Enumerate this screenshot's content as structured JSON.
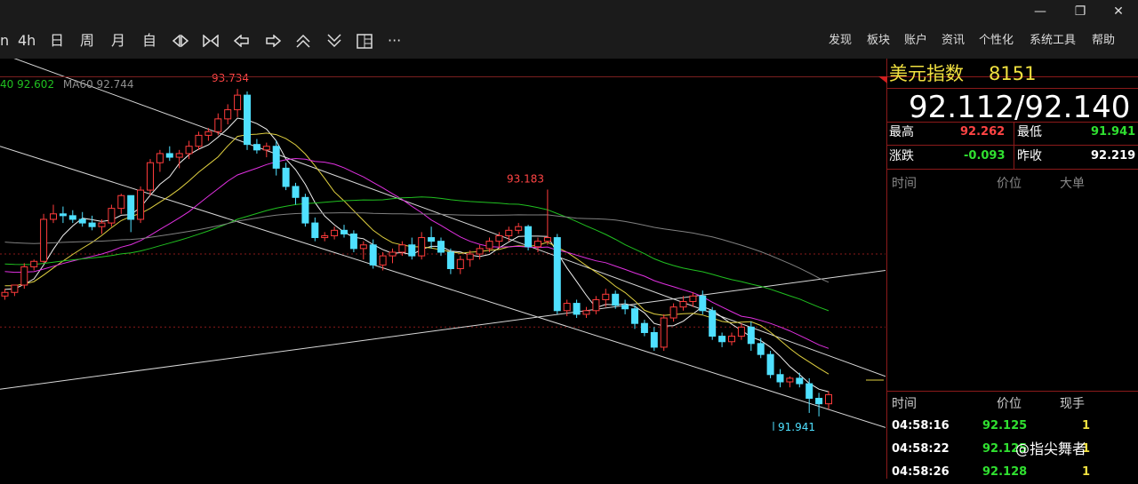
{
  "window": {
    "restore_glyph": "❐",
    "minimize_glyph": "—",
    "close_glyph": "✕"
  },
  "toolbar": {
    "periods": [
      "n",
      "4h",
      "日",
      "周",
      "月",
      "自"
    ],
    "tools": [
      "zoom-in-icon",
      "zoom-out-icon",
      "move-left-icon",
      "move-right-icon",
      "scroll-up-icon",
      "scroll-down-icon",
      "layout-icon",
      "more-icon"
    ],
    "more_label": "···",
    "menu": [
      "发现",
      "板块",
      "账户",
      "资讯",
      "个性化",
      "系统工具",
      "帮助"
    ]
  },
  "legend": {
    "ma40": "40 92.602",
    "ma60": "MA60 92.744"
  },
  "chart_data": {
    "type": "candlestick",
    "ylim": [
      91.6,
      93.9
    ],
    "annotations": [
      {
        "text": "93.734",
        "value": 93.734,
        "color": "#ff4444"
      },
      {
        "text": "93.183",
        "value": 93.183,
        "color": "#ff4444"
      },
      {
        "text": "91.941",
        "value": 91.941,
        "color": "#4fe0ff"
      }
    ],
    "candles": [
      [
        92.6,
        92.64,
        92.58,
        92.62
      ],
      [
        92.62,
        92.66,
        92.6,
        92.66
      ],
      [
        92.66,
        92.78,
        92.64,
        92.76
      ],
      [
        92.76,
        92.8,
        92.74,
        92.79
      ],
      [
        92.79,
        93.05,
        92.78,
        93.02
      ],
      [
        93.02,
        93.1,
        93.0,
        93.05
      ],
      [
        93.05,
        93.09,
        93.0,
        93.04
      ],
      [
        93.04,
        93.07,
        93.0,
        93.02
      ],
      [
        93.02,
        93.06,
        92.98,
        93.0
      ],
      [
        93.0,
        93.04,
        92.96,
        92.98
      ],
      [
        92.98,
        93.02,
        92.94,
        93.0
      ],
      [
        93.0,
        93.1,
        92.98,
        93.08
      ],
      [
        93.08,
        93.16,
        93.05,
        93.15
      ],
      [
        93.15,
        93.13,
        92.95,
        93.02
      ],
      [
        93.02,
        93.2,
        93.0,
        93.18
      ],
      [
        93.18,
        93.35,
        93.15,
        93.33
      ],
      [
        93.33,
        93.4,
        93.28,
        93.38
      ],
      [
        93.38,
        93.42,
        93.34,
        93.36
      ],
      [
        93.36,
        93.4,
        93.3,
        93.38
      ],
      [
        93.38,
        93.45,
        93.35,
        93.42
      ],
      [
        93.42,
        93.5,
        93.4,
        93.48
      ],
      [
        93.48,
        93.52,
        93.45,
        93.5
      ],
      [
        93.5,
        93.6,
        93.48,
        93.57
      ],
      [
        93.57,
        93.65,
        93.54,
        93.62
      ],
      [
        93.62,
        93.734,
        93.58,
        93.7
      ],
      [
        93.7,
        93.72,
        93.4,
        93.43
      ],
      [
        93.43,
        93.46,
        93.38,
        93.4
      ],
      [
        93.4,
        93.44,
        93.36,
        93.42
      ],
      [
        93.42,
        93.45,
        93.26,
        93.3
      ],
      [
        93.3,
        93.33,
        93.18,
        93.2
      ],
      [
        93.2,
        93.22,
        93.1,
        93.14
      ],
      [
        93.14,
        93.16,
        92.98,
        93.0
      ],
      [
        93.0,
        93.03,
        92.9,
        92.92
      ],
      [
        92.92,
        92.95,
        92.9,
        92.93
      ],
      [
        92.93,
        92.98,
        92.91,
        92.96
      ],
      [
        92.96,
        92.99,
        92.92,
        92.94
      ],
      [
        92.94,
        92.96,
        92.84,
        92.86
      ],
      [
        92.86,
        92.9,
        92.8,
        92.88
      ],
      [
        92.88,
        92.91,
        92.75,
        92.77
      ],
      [
        92.77,
        92.84,
        92.74,
        92.82
      ],
      [
        92.82,
        92.86,
        92.78,
        92.84
      ],
      [
        92.84,
        92.9,
        92.82,
        92.88
      ],
      [
        92.88,
        92.92,
        92.8,
        92.82
      ],
      [
        92.82,
        92.95,
        92.8,
        92.92
      ],
      [
        92.92,
        92.98,
        92.86,
        92.9
      ],
      [
        92.9,
        92.92,
        92.82,
        92.84
      ],
      [
        92.84,
        92.86,
        92.72,
        92.75
      ],
      [
        92.75,
        92.82,
        92.72,
        92.8
      ],
      [
        92.8,
        92.85,
        92.76,
        92.83
      ],
      [
        92.83,
        92.88,
        92.8,
        92.86
      ],
      [
        92.86,
        92.92,
        92.84,
        92.9
      ],
      [
        92.9,
        92.95,
        92.86,
        92.93
      ],
      [
        92.93,
        92.98,
        92.9,
        92.96
      ],
      [
        92.96,
        93.0,
        92.94,
        92.98
      ],
      [
        92.98,
        92.99,
        92.85,
        92.87
      ],
      [
        92.87,
        92.92,
        92.84,
        92.9
      ],
      [
        92.9,
        93.183,
        92.88,
        92.92
      ],
      [
        92.92,
        92.94,
        92.5,
        92.52
      ],
      [
        92.52,
        92.58,
        92.49,
        92.56
      ],
      [
        92.56,
        92.58,
        92.48,
        92.5
      ],
      [
        92.5,
        92.54,
        92.48,
        92.52
      ],
      [
        92.52,
        92.6,
        92.5,
        92.58
      ],
      [
        92.58,
        92.64,
        92.54,
        92.61
      ],
      [
        92.61,
        92.63,
        92.53,
        92.55
      ],
      [
        92.55,
        92.58,
        92.5,
        92.53
      ],
      [
        92.53,
        92.55,
        92.42,
        92.45
      ],
      [
        92.45,
        92.47,
        92.38,
        92.4
      ],
      [
        92.4,
        92.43,
        92.3,
        92.32
      ],
      [
        92.32,
        92.5,
        92.3,
        92.48
      ],
      [
        92.48,
        92.56,
        92.46,
        92.54
      ],
      [
        92.54,
        92.6,
        92.52,
        92.57
      ],
      [
        92.57,
        92.62,
        92.54,
        92.6
      ],
      [
        92.6,
        92.63,
        92.5,
        92.52
      ],
      [
        92.52,
        92.54,
        92.36,
        92.38
      ],
      [
        92.38,
        92.4,
        92.32,
        92.35
      ],
      [
        92.35,
        92.4,
        92.33,
        92.38
      ],
      [
        92.38,
        92.45,
        92.36,
        92.43
      ],
      [
        92.43,
        92.46,
        92.3,
        92.34
      ],
      [
        92.34,
        92.37,
        92.26,
        92.28
      ],
      [
        92.28,
        92.3,
        92.15,
        92.17
      ],
      [
        92.17,
        92.2,
        92.1,
        92.13
      ],
      [
        92.13,
        92.16,
        92.1,
        92.15
      ],
      [
        92.15,
        92.18,
        92.1,
        92.12
      ],
      [
        92.12,
        92.15,
        91.96,
        92.04
      ],
      [
        92.04,
        92.07,
        91.941,
        92.01
      ],
      [
        92.01,
        92.08,
        91.98,
        92.06
      ]
    ],
    "ma_series": [
      {
        "name": "MA5",
        "color": "#f0f0f0",
        "values": []
      },
      {
        "name": "MA10",
        "color": "#e0d040",
        "values": []
      },
      {
        "name": "MA20",
        "color": "#e030e0",
        "values": []
      },
      {
        "name": "MA40",
        "color": "#20c020",
        "values": []
      },
      {
        "name": "MA60",
        "color": "#808080",
        "values": []
      }
    ]
  },
  "panel": {
    "title": "美元指数",
    "code": "8151",
    "price": "92.112/92.140",
    "high_label": "最高",
    "high": "92.262",
    "low_label": "最低",
    "low": "91.941",
    "change_label": "涨跌",
    "change": "-0.093",
    "prev_label": "昨收",
    "prev": "92.219",
    "big_header": [
      "时间",
      "价位",
      "大单"
    ],
    "tick_header": [
      "时间",
      "价位",
      "现手"
    ],
    "ticks": [
      {
        "time": "04:58:16",
        "price": "92.125",
        "qty": "1"
      },
      {
        "time": "04:58:22",
        "price": "92.125",
        "qty": "1"
      },
      {
        "time": "04:58:26",
        "price": "92.128",
        "qty": "1"
      }
    ]
  },
  "watermark": "@指尖舞者"
}
